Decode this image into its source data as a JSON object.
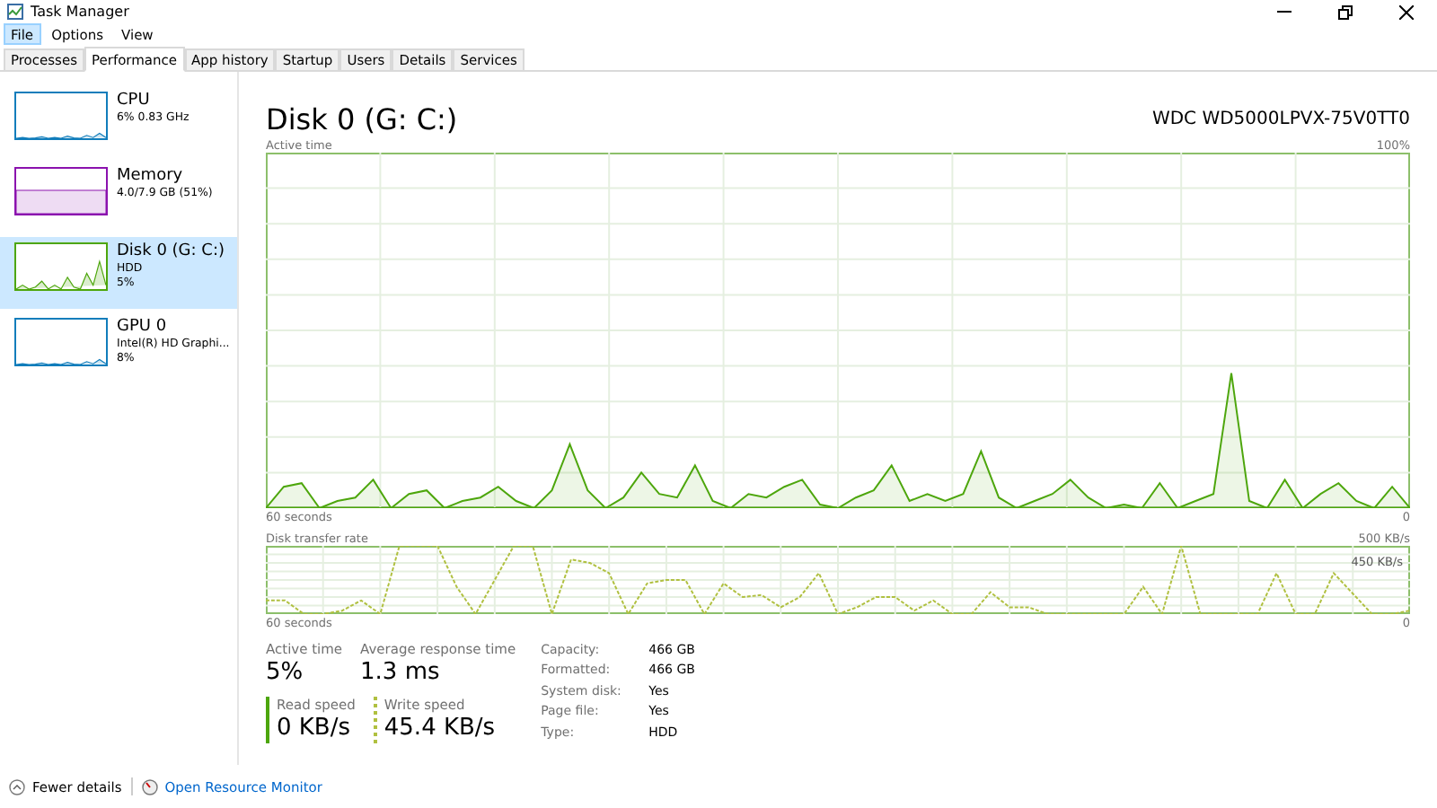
{
  "window": {
    "title": "Task Manager"
  },
  "menu": [
    {
      "label": "File",
      "selected": true
    },
    {
      "label": "Options",
      "selected": false
    },
    {
      "label": "View",
      "selected": false
    }
  ],
  "tabs": [
    {
      "label": "Processes",
      "selected": false
    },
    {
      "label": "Performance",
      "selected": true
    },
    {
      "label": "App history",
      "selected": false
    },
    {
      "label": "Startup",
      "selected": false
    },
    {
      "label": "Users",
      "selected": false
    },
    {
      "label": "Details",
      "selected": false
    },
    {
      "label": "Services",
      "selected": false
    }
  ],
  "sidebar": {
    "items": [
      {
        "name": "CPU",
        "lines": [
          "6%  0.83 GHz"
        ],
        "selected": false,
        "color": "#117dbb"
      },
      {
        "name": "Memory",
        "lines": [
          "4.0/7.9 GB (51%)"
        ],
        "selected": false,
        "color": "#8b12ae"
      },
      {
        "name": "Disk 0 (G: C:)",
        "lines": [
          "HDD",
          "5%"
        ],
        "selected": true,
        "color": "#4da60c"
      },
      {
        "name": "GPU 0",
        "lines": [
          "Intel(R) HD Graphi...",
          "8%"
        ],
        "selected": false,
        "color": "#117dbb"
      }
    ]
  },
  "detail": {
    "title": "Disk 0 (G: C:)",
    "model": "WDC WD5000LPVX-75V0TT0",
    "active_chart": {
      "label": "Active time",
      "max": "100%",
      "time": "60 seconds",
      "min": "0"
    },
    "rate_chart": {
      "label": "Disk transfer rate",
      "max": "500 KB/s",
      "marker": "450 KB/s",
      "time": "60 seconds",
      "min": "0"
    },
    "stats": [
      {
        "label": "Active time",
        "value": "5%"
      },
      {
        "label": "Average response time",
        "value": "1.3 ms"
      }
    ],
    "speeds": [
      {
        "kind": "read",
        "label": "Read speed",
        "value": "0 KB/s"
      },
      {
        "kind": "write",
        "label": "Write speed",
        "value": "45.4 KB/s"
      }
    ],
    "properties": [
      {
        "label": "Capacity:",
        "value": "466 GB"
      },
      {
        "label": "Formatted:",
        "value": "466 GB"
      },
      {
        "label": "System disk:",
        "value": "Yes"
      },
      {
        "label": "Page file:",
        "value": "Yes"
      },
      {
        "label": "Type:",
        "value": "HDD"
      }
    ]
  },
  "footer": {
    "fewer": "Fewer details",
    "monitor": "Open Resource Monitor"
  }
}
